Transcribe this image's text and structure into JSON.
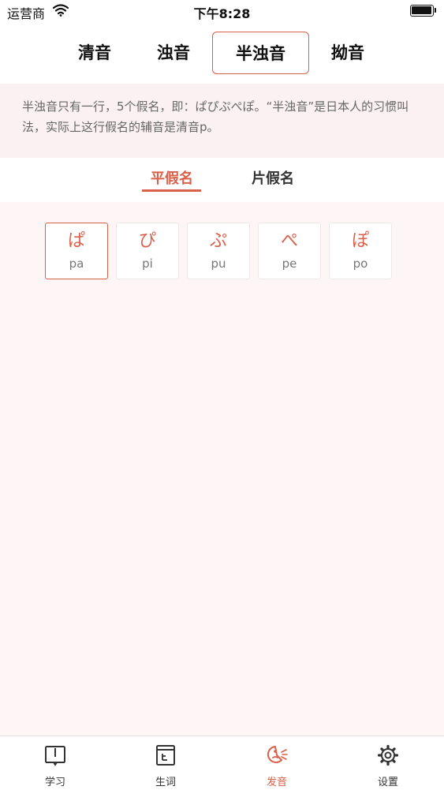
{
  "status_bar": {
    "carrier": "运营商",
    "time": "下午8:28"
  },
  "category_tabs": [
    {
      "label": "清音",
      "active": false
    },
    {
      "label": "浊音",
      "active": false
    },
    {
      "label": "半浊音",
      "active": true
    },
    {
      "label": "拗音",
      "active": false
    }
  ],
  "description": "半浊音只有一行，5个假名，即：ぱぴぷぺぽ。“半浊音”是日本人的习惯叫法，实际上这行假名的辅音是清音p。",
  "script_tabs": [
    {
      "label": "平假名",
      "active": true
    },
    {
      "label": "片假名",
      "active": false
    }
  ],
  "kana": [
    {
      "char": "ぱ",
      "romaji": "pa",
      "selected": true
    },
    {
      "char": "ぴ",
      "romaji": "pi",
      "selected": false
    },
    {
      "char": "ぷ",
      "romaji": "pu",
      "selected": false
    },
    {
      "char": "ぺ",
      "romaji": "pe",
      "selected": false
    },
    {
      "char": "ぽ",
      "romaji": "po",
      "selected": false
    }
  ],
  "tab_bar": [
    {
      "label": "学习",
      "icon": "book-icon",
      "active": false
    },
    {
      "label": "生词",
      "icon": "vocabulary-icon",
      "active": false
    },
    {
      "label": "发音",
      "icon": "pronunciation-icon",
      "active": true
    },
    {
      "label": "设置",
      "icon": "gear-icon",
      "active": false
    }
  ],
  "colors": {
    "accent": "#d9604a",
    "background": "#fdf5f6",
    "text": "#222222",
    "muted": "#777777"
  }
}
